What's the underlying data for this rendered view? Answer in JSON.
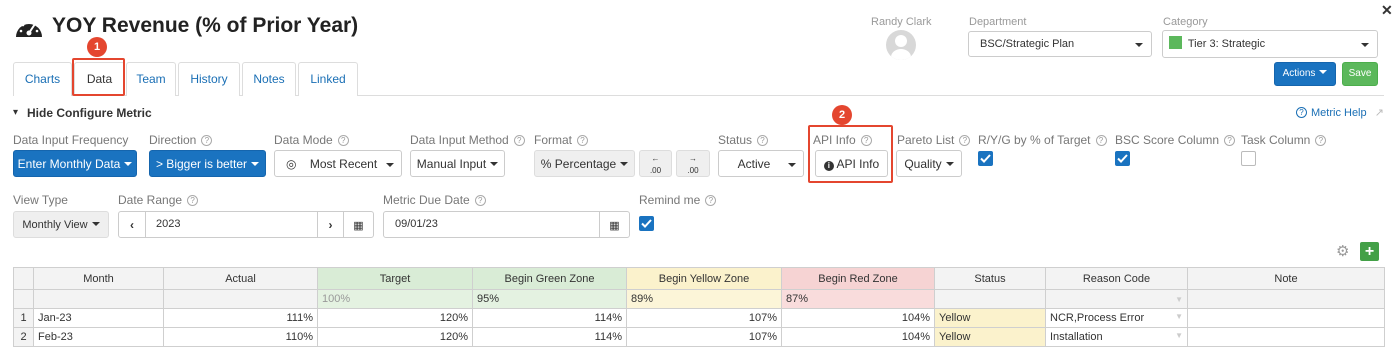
{
  "header": {
    "title": "YOY Revenue (% of Prior Year)",
    "user_name": "Randy Clark",
    "department_label": "Department",
    "department_value": "BSC/Strategic Plan",
    "category_label": "Category",
    "category_value": "Tier 3: Strategic",
    "category_swatch": "#5cb85c",
    "actions_label": "Actions",
    "save_label": "Save"
  },
  "tabs": [
    {
      "label": "Charts"
    },
    {
      "label": "Data"
    },
    {
      "label": "History"
    },
    {
      "label": "Team"
    },
    {
      "label": "Notes"
    },
    {
      "label": "Linked"
    }
  ],
  "annotations": {
    "badge1": "1",
    "badge2": "2"
  },
  "config": {
    "toggle_label": "Hide Configure Metric",
    "help_label": "Metric Help",
    "frequency_label": "Data Input Frequency",
    "frequency_value": "Enter Monthly Data",
    "direction_label": "Direction",
    "direction_value": "> Bigger is better",
    "mode_label": "Data Mode",
    "mode_value": "Most Recent",
    "method_label": "Data Input Method",
    "method_value": "Manual Input",
    "format_label": "Format",
    "format_value": "% Percentage",
    "dec_down": ".00",
    "dec_up": ".00",
    "status_label": "Status",
    "status_value": "Active",
    "api_label": "API Info",
    "api_button": "API Info",
    "pareto_label": "Pareto List",
    "pareto_value": "Quality",
    "ryg_label": "R/Y/G by % of Target",
    "bsc_label": "BSC Score Column",
    "task_label": "Task Column"
  },
  "view": {
    "view_type_label": "View Type",
    "view_type_value": "Monthly View",
    "date_range_label": "Date Range",
    "date_range_value": "2023",
    "due_date_label": "Metric Due Date",
    "due_date_value": "09/01/23",
    "remind_label": "Remind me"
  },
  "grid": {
    "headers": [
      "Month",
      "Actual",
      "Target",
      "Begin Green Zone",
      "Begin Yellow Zone",
      "Begin Red Zone",
      "Status",
      "Reason Code",
      "Note"
    ],
    "defaults": {
      "target": "100%",
      "green": "95%",
      "yellow": "89%",
      "red": "87%"
    },
    "rows": [
      {
        "n": "1",
        "month": "Jan-23",
        "actual": "111%",
        "target": "120%",
        "green": "114%",
        "yellow": "107%",
        "red": "104%",
        "status": "Yellow",
        "reason": "NCR,Process Error",
        "note": ""
      },
      {
        "n": "2",
        "month": "Feb-23",
        "actual": "110%",
        "target": "120%",
        "green": "114%",
        "yellow": "107%",
        "red": "104%",
        "status": "Yellow",
        "reason": "Installation",
        "note": ""
      }
    ]
  }
}
